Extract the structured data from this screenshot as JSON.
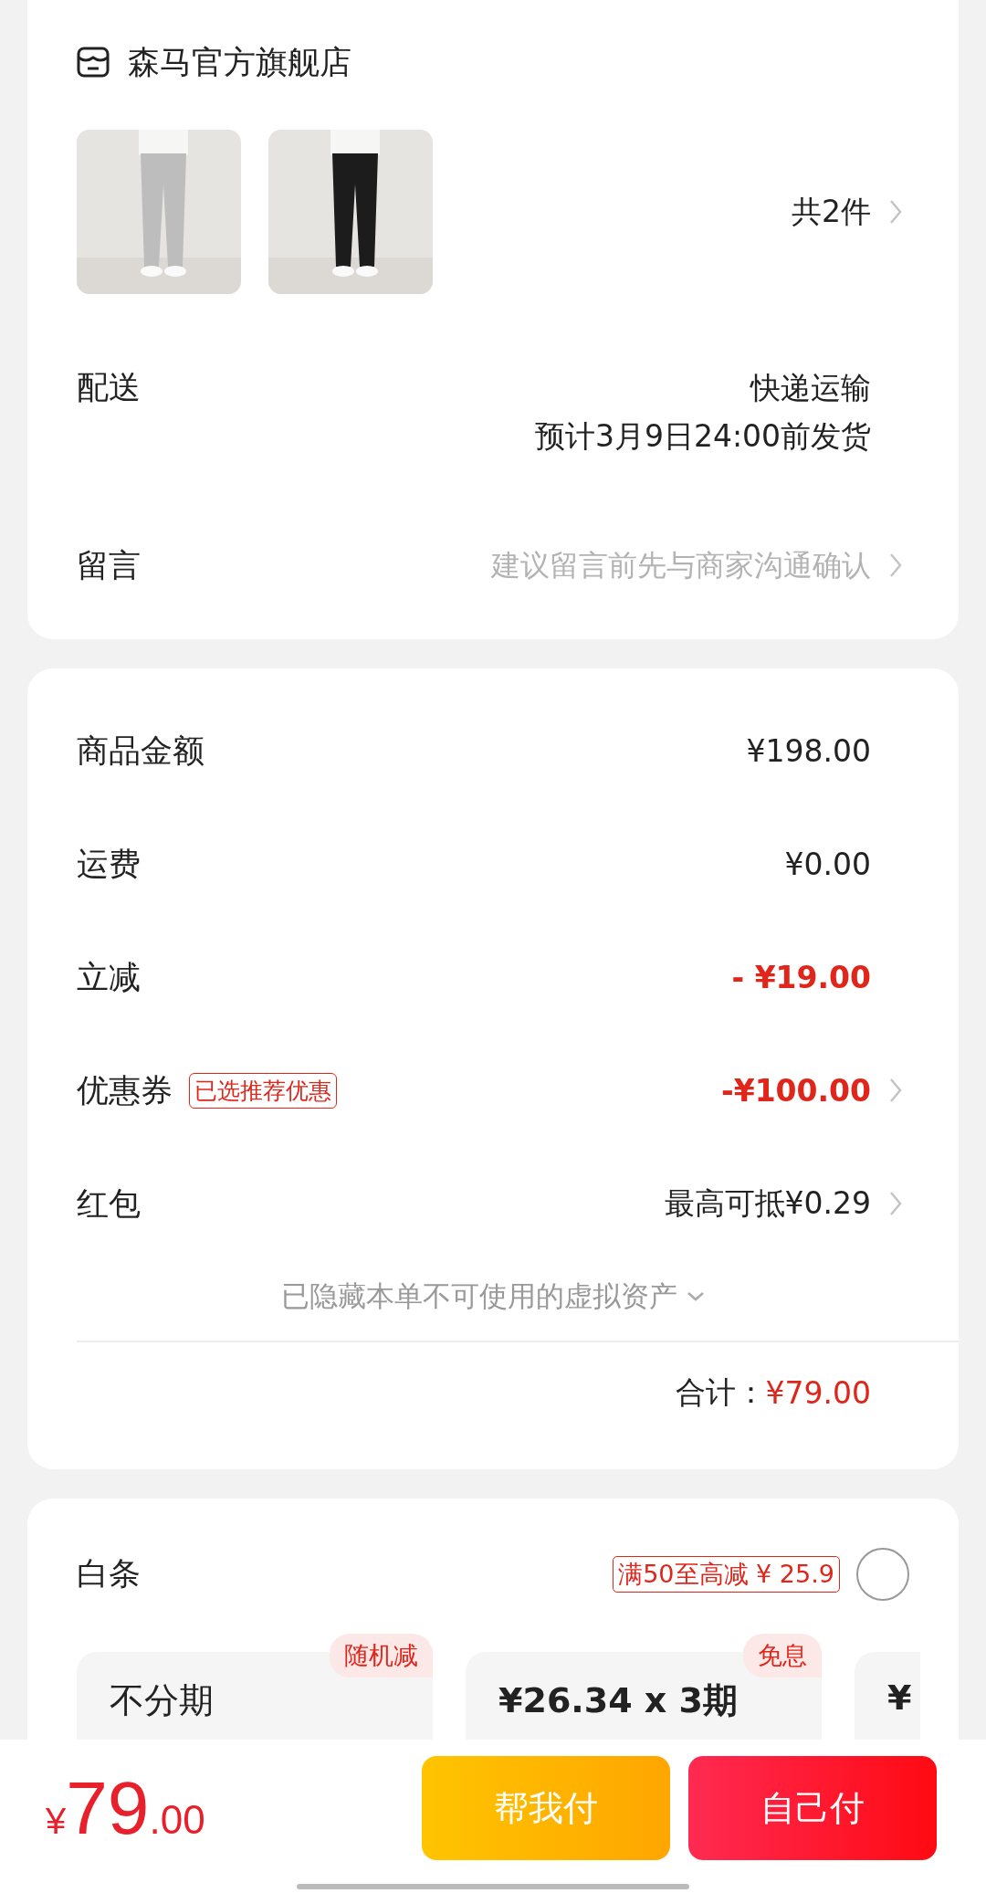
{
  "store": {
    "name": "森马官方旗舰店"
  },
  "items_count": "共2件",
  "delivery": {
    "label": "配送",
    "method": "快递运输",
    "eta": "预计3月9日24:00前发货"
  },
  "message": {
    "label": "留言",
    "placeholder": "建议留言前先与商家沟通确认"
  },
  "costs": [
    {
      "label": "商品金额",
      "value": "¥198.00",
      "kind": "plain",
      "chevron": false
    },
    {
      "label": "运费",
      "value": "¥0.00",
      "kind": "plain",
      "chevron": false
    },
    {
      "label": "立减",
      "value": "- ¥19.00",
      "kind": "discount",
      "chevron": false
    },
    {
      "label": "优惠券",
      "tag": "已选推荐优惠",
      "value": "-¥100.00",
      "kind": "discount",
      "chevron": true
    },
    {
      "label": "红包",
      "value": "最高可抵¥0.29",
      "kind": "plain",
      "chevron": true
    }
  ],
  "hidden_assets": "已隐藏本单不可使用的虚拟资产",
  "total": {
    "label": "合计：",
    "value": "¥79.00"
  },
  "baitiao": {
    "label": "白条",
    "promo": "满50至高减 ¥ 25.9",
    "selected": false,
    "plans": [
      {
        "title": "不分期",
        "badge": "随机减"
      },
      {
        "title": "¥26.34 x 3期",
        "badge": "免息"
      },
      {
        "title": "¥"
      }
    ]
  },
  "bottom": {
    "currency": "¥",
    "integer": "79",
    "decimal": ".00",
    "buttons": [
      {
        "label": "帮我付",
        "kind": "secondary"
      },
      {
        "label": "自己付",
        "kind": "primary"
      }
    ]
  }
}
